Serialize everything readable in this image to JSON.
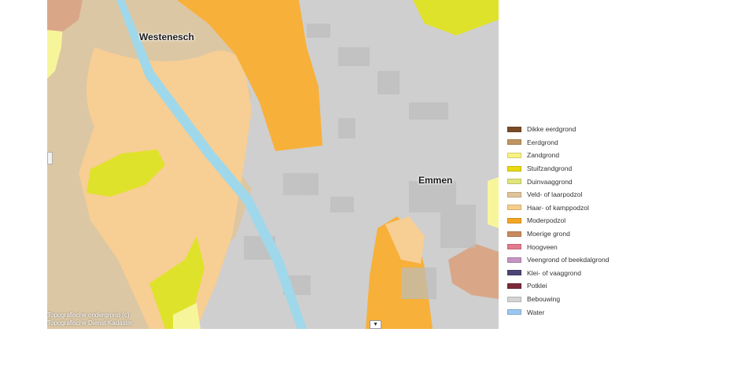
{
  "map": {
    "places": [
      {
        "id": "westenesch",
        "name": "Westenesch"
      },
      {
        "id": "emmen",
        "name": "Emmen"
      }
    ],
    "attribution": [
      "Topografische ondergrond (c)",
      "Topografische Dienst Kadaster"
    ],
    "colors": {
      "built_up": "#cfcfcf",
      "water": "#9fd8ea",
      "podzol_orange": "#f7b039",
      "light_podzol": "#f7ce94",
      "earth_tan": "#dcc7a4",
      "yellow_green": "#dfe22a",
      "pale_yellow": "#f7f59a",
      "brown_soil": "#d9a788"
    },
    "dropdown_icon": "chevron-down-icon"
  },
  "legend": {
    "items": [
      {
        "label": "Dikke eerdgrond",
        "color": "#7a4a25"
      },
      {
        "label": "Eerdgrond",
        "color": "#c19461"
      },
      {
        "label": "Zandgrond",
        "color": "#f7f282"
      },
      {
        "label": "Stuifzandgrond",
        "color": "#e9da10"
      },
      {
        "label": "Duinvaaggrond",
        "color": "#dfe57a"
      },
      {
        "label": "Veld- of laarpodzol",
        "color": "#e0c39a"
      },
      {
        "label": "Haar- of kamppodzol",
        "color": "#f7cd8b"
      },
      {
        "label": "Moderpodzol",
        "color": "#f5a623"
      },
      {
        "label": "Moerige grond",
        "color": "#c88a5e"
      },
      {
        "label": "Hoogveen",
        "color": "#e47a8e"
      },
      {
        "label": "Veengrond of beekdalgrond",
        "color": "#c595c2"
      },
      {
        "label": "Klei- of vaaggrond",
        "color": "#4a4575"
      },
      {
        "label": "Potklei",
        "color": "#7a2a3a"
      },
      {
        "label": "Bebouwing",
        "color": "#d4d4d4"
      },
      {
        "label": "Water",
        "color": "#9cc8ef"
      }
    ]
  }
}
